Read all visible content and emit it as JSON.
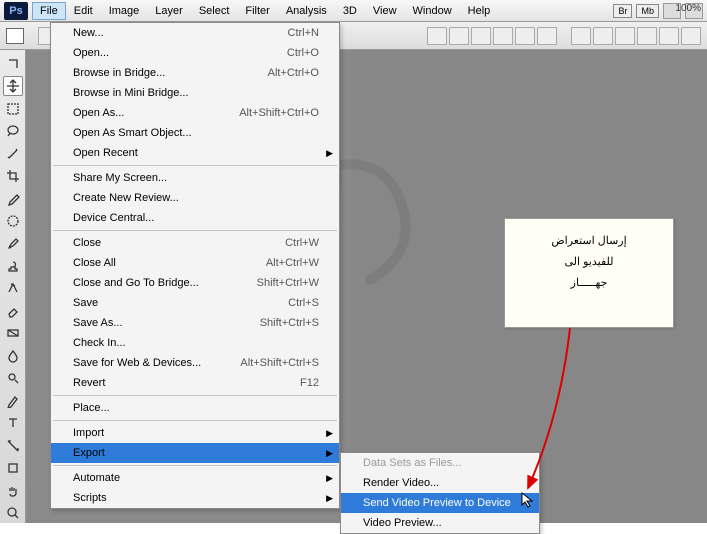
{
  "menubar": {
    "items": [
      "File",
      "Edit",
      "Image",
      "Layer",
      "Select",
      "Filter",
      "Analysis",
      "3D",
      "View",
      "Window",
      "Help"
    ],
    "open_index": 0
  },
  "badges": {
    "br": "Br",
    "mb": "Mb"
  },
  "zoom_label": "100%",
  "ps_logo": "Ps",
  "file_menu": {
    "groups": [
      [
        {
          "label": "New...",
          "sc": "Ctrl+N"
        },
        {
          "label": "Open...",
          "sc": "Ctrl+O"
        },
        {
          "label": "Browse in Bridge...",
          "sc": "Alt+Ctrl+O"
        },
        {
          "label": "Browse in Mini Bridge...",
          "sc": ""
        },
        {
          "label": "Open As...",
          "sc": "Alt+Shift+Ctrl+O"
        },
        {
          "label": "Open As Smart Object...",
          "sc": ""
        },
        {
          "label": "Open Recent",
          "sc": "",
          "sub": true
        }
      ],
      [
        {
          "label": "Share My Screen...",
          "sc": ""
        },
        {
          "label": "Create New Review...",
          "sc": ""
        },
        {
          "label": "Device Central...",
          "sc": ""
        }
      ],
      [
        {
          "label": "Close",
          "sc": "Ctrl+W"
        },
        {
          "label": "Close All",
          "sc": "Alt+Ctrl+W"
        },
        {
          "label": "Close and Go To Bridge...",
          "sc": "Shift+Ctrl+W"
        },
        {
          "label": "Save",
          "sc": "Ctrl+S"
        },
        {
          "label": "Save As...",
          "sc": "Shift+Ctrl+S"
        },
        {
          "label": "Check In...",
          "sc": "",
          "disabled": true
        },
        {
          "label": "Save for Web & Devices...",
          "sc": "Alt+Shift+Ctrl+S"
        },
        {
          "label": "Revert",
          "sc": "F12",
          "disabled": true
        }
      ],
      [
        {
          "label": "Place...",
          "sc": ""
        }
      ],
      [
        {
          "label": "Import",
          "sc": "",
          "sub": true
        },
        {
          "label": "Export",
          "sc": "",
          "sub": true,
          "highlight": true
        }
      ],
      [
        {
          "label": "Automate",
          "sc": "",
          "sub": true
        },
        {
          "label": "Scripts",
          "sc": "",
          "sub": true
        }
      ]
    ]
  },
  "export_submenu": {
    "items": [
      {
        "label": "Data Sets as Files...",
        "disabled": true
      },
      {
        "label": "Render Video..."
      },
      {
        "label": "Send Video Preview to Device",
        "highlight": true
      },
      {
        "label": "Video Preview..."
      }
    ]
  },
  "note": {
    "line1": "إرسال استعراض",
    "line2": "للفيديو الى",
    "line3": "جهـــــاز"
  },
  "tools": [
    "grab",
    "move",
    "marquee",
    "lasso",
    "wand",
    "crop",
    "eyedrop",
    "heal",
    "brush",
    "stamp",
    "history",
    "eraser",
    "gradient",
    "blur",
    "dodge",
    "pen",
    "type",
    "path",
    "rect",
    "hand",
    "zoom"
  ]
}
